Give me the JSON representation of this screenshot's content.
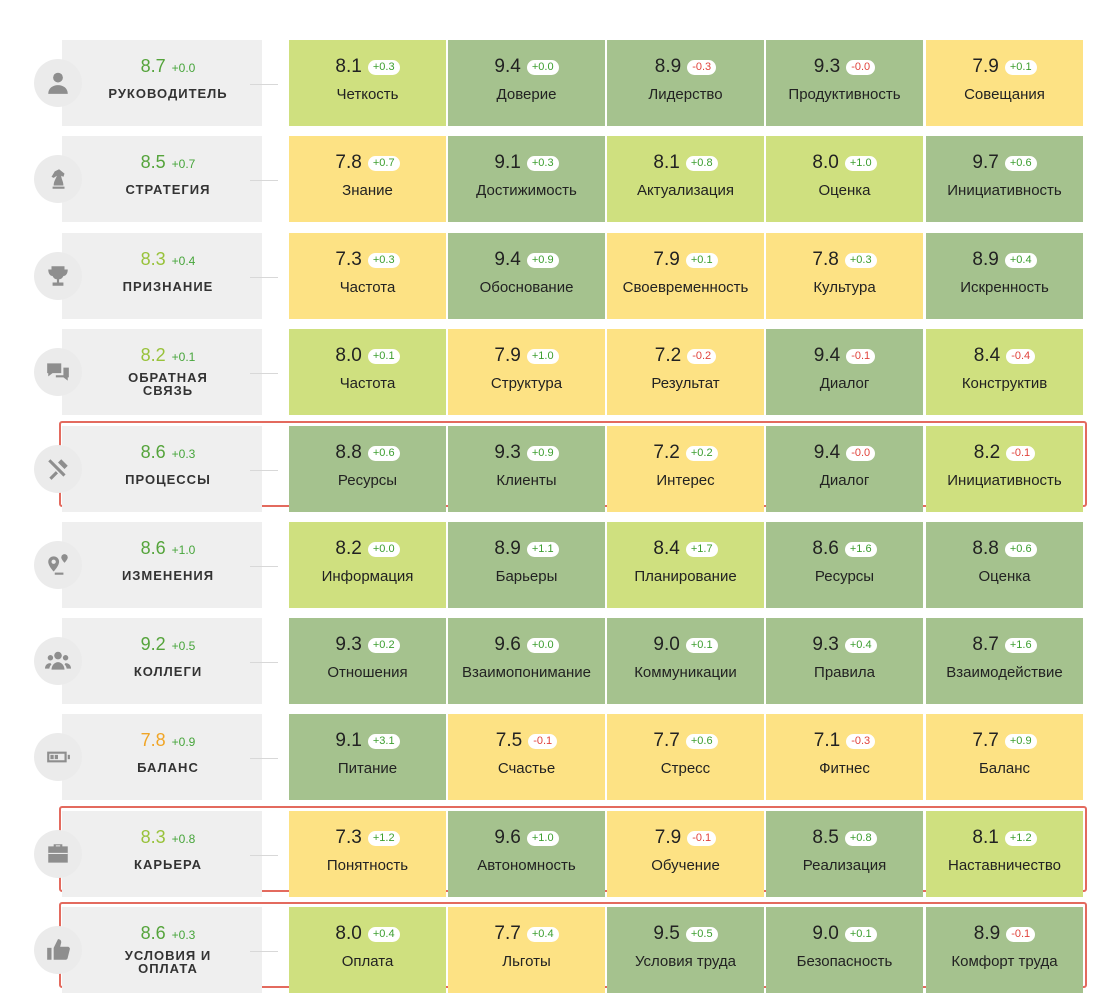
{
  "colors": {
    "dark_green": "#a5c28e",
    "yellow": "#fde284",
    "light_green": "#cfe07f",
    "highlight_border": "#e36a5e",
    "positive": "#3c9e2f",
    "negative": "#e0433c"
  },
  "rows": [
    {
      "icon": "person-icon",
      "score": "8.7",
      "delta": "+0.0",
      "name": "РУКОВОДИТЕЛЬ",
      "score_color": "#55a43b",
      "highlighted": false,
      "cells": [
        {
          "v": "8.1",
          "d": "+0.3",
          "l": "Четкость",
          "c": "lg"
        },
        {
          "v": "9.4",
          "d": "+0.0",
          "l": "Доверие",
          "c": "g"
        },
        {
          "v": "8.9",
          "d": "-0.3",
          "l": "Лидерство",
          "c": "g"
        },
        {
          "v": "9.3",
          "d": "-0.0",
          "l": "Продуктивность",
          "c": "g"
        },
        {
          "v": "7.9",
          "d": "+0.1",
          "l": "Совещания",
          "c": "y"
        }
      ]
    },
    {
      "icon": "chess-knight-icon",
      "score": "8.5",
      "delta": "+0.7",
      "name": "СТРАТЕГИЯ",
      "score_color": "#55a43b",
      "highlighted": false,
      "cells": [
        {
          "v": "7.8",
          "d": "+0.7",
          "l": "Знание",
          "c": "y"
        },
        {
          "v": "9.1",
          "d": "+0.3",
          "l": "Достижимость",
          "c": "g"
        },
        {
          "v": "8.1",
          "d": "+0.8",
          "l": "Актуализация",
          "c": "lg"
        },
        {
          "v": "8.0",
          "d": "+1.0",
          "l": "Оценка",
          "c": "lg"
        },
        {
          "v": "9.7",
          "d": "+0.6",
          "l": "Инициативность",
          "c": "g"
        }
      ]
    },
    {
      "icon": "trophy-icon",
      "score": "8.3",
      "delta": "+0.4",
      "name": "ПРИЗНАНИЕ",
      "score_color": "#98c23a",
      "highlighted": false,
      "cells": [
        {
          "v": "7.3",
          "d": "+0.3",
          "l": "Частота",
          "c": "y"
        },
        {
          "v": "9.4",
          "d": "+0.9",
          "l": "Обоснование",
          "c": "g"
        },
        {
          "v": "7.9",
          "d": "+0.1",
          "l": "Своевременность",
          "c": "y"
        },
        {
          "v": "7.8",
          "d": "+0.3",
          "l": "Культура",
          "c": "y"
        },
        {
          "v": "8.9",
          "d": "+0.4",
          "l": "Искренность",
          "c": "g"
        }
      ]
    },
    {
      "icon": "chat-bubbles-icon",
      "score": "8.2",
      "delta": "+0.1",
      "name": "ОБРАТНАЯ СВЯЗЬ",
      "score_color": "#98c23a",
      "highlighted": false,
      "cells": [
        {
          "v": "8.0",
          "d": "+0.1",
          "l": "Частота",
          "c": "lg"
        },
        {
          "v": "7.9",
          "d": "+1.0",
          "l": "Структура",
          "c": "y"
        },
        {
          "v": "7.2",
          "d": "-0.2",
          "l": "Результат",
          "c": "y"
        },
        {
          "v": "9.4",
          "d": "-0.1",
          "l": "Диалог",
          "c": "g"
        },
        {
          "v": "8.4",
          "d": "-0.4",
          "l": "Конструктив",
          "c": "lg"
        }
      ]
    },
    {
      "icon": "tools-icon",
      "score": "8.6",
      "delta": "+0.3",
      "name": "ПРОЦЕССЫ",
      "score_color": "#55a43b",
      "highlighted": true,
      "cells": [
        {
          "v": "8.8",
          "d": "+0.6",
          "l": "Ресурсы",
          "c": "g"
        },
        {
          "v": "9.3",
          "d": "+0.9",
          "l": "Клиенты",
          "c": "g"
        },
        {
          "v": "7.2",
          "d": "+0.2",
          "l": "Интерес",
          "c": "y"
        },
        {
          "v": "9.4",
          "d": "-0.0",
          "l": "Диалог",
          "c": "g"
        },
        {
          "v": "8.2",
          "d": "-0.1",
          "l": "Инициативность",
          "c": "lg"
        }
      ]
    },
    {
      "icon": "route-pin-icon",
      "score": "8.6",
      "delta": "+1.0",
      "name": "ИЗМЕНЕНИЯ",
      "score_color": "#55a43b",
      "highlighted": false,
      "cells": [
        {
          "v": "8.2",
          "d": "+0.0",
          "l": "Информация",
          "c": "lg"
        },
        {
          "v": "8.9",
          "d": "+1.1",
          "l": "Барьеры",
          "c": "g"
        },
        {
          "v": "8.4",
          "d": "+1.7",
          "l": "Планирование",
          "c": "lg"
        },
        {
          "v": "8.6",
          "d": "+1.6",
          "l": "Ресурсы",
          "c": "g"
        },
        {
          "v": "8.8",
          "d": "+0.6",
          "l": "Оценка",
          "c": "g"
        }
      ]
    },
    {
      "icon": "group-icon",
      "score": "9.2",
      "delta": "+0.5",
      "name": "КОЛЛЕГИ",
      "score_color": "#55a43b",
      "highlighted": false,
      "cells": [
        {
          "v": "9.3",
          "d": "+0.2",
          "l": "Отношения",
          "c": "g"
        },
        {
          "v": "9.6",
          "d": "+0.0",
          "l": "Взаимопонимание",
          "c": "g"
        },
        {
          "v": "9.0",
          "d": "+0.1",
          "l": "Коммуникации",
          "c": "g"
        },
        {
          "v": "9.3",
          "d": "+0.4",
          "l": "Правила",
          "c": "g"
        },
        {
          "v": "8.7",
          "d": "+1.6",
          "l": "Взаимодействие",
          "c": "g"
        }
      ]
    },
    {
      "icon": "battery-icon",
      "score": "7.8",
      "delta": "+0.9",
      "name": "БАЛАНС",
      "score_color": "#f0a526",
      "highlighted": false,
      "cells": [
        {
          "v": "9.1",
          "d": "+3.1",
          "l": "Питание",
          "c": "g"
        },
        {
          "v": "7.5",
          "d": "-0.1",
          "l": "Счастье",
          "c": "y"
        },
        {
          "v": "7.7",
          "d": "+0.6",
          "l": "Стресс",
          "c": "y"
        },
        {
          "v": "7.1",
          "d": "-0.3",
          "l": "Фитнес",
          "c": "y"
        },
        {
          "v": "7.7",
          "d": "+0.9",
          "l": "Баланс",
          "c": "y"
        }
      ]
    },
    {
      "icon": "briefcase-icon",
      "score": "8.3",
      "delta": "+0.8",
      "name": "КАРЬЕРА",
      "score_color": "#98c23a",
      "highlighted": true,
      "cells": [
        {
          "v": "7.3",
          "d": "+1.2",
          "l": "Понятность",
          "c": "y"
        },
        {
          "v": "9.6",
          "d": "+1.0",
          "l": "Автономность",
          "c": "g"
        },
        {
          "v": "7.9",
          "d": "-0.1",
          "l": "Обучение",
          "c": "y"
        },
        {
          "v": "8.5",
          "d": "+0.8",
          "l": "Реализация",
          "c": "g"
        },
        {
          "v": "8.1",
          "d": "+1.2",
          "l": "Наставничество",
          "c": "lg"
        }
      ]
    },
    {
      "icon": "thumbs-up-icon",
      "score": "8.6",
      "delta": "+0.3",
      "name": "УСЛОВИЯ И ОПЛАТА",
      "score_color": "#55a43b",
      "highlighted": true,
      "cells": [
        {
          "v": "8.0",
          "d": "+0.4",
          "l": "Оплата",
          "c": "lg"
        },
        {
          "v": "7.7",
          "d": "+0.4",
          "l": "Льготы",
          "c": "y"
        },
        {
          "v": "9.5",
          "d": "+0.5",
          "l": "Условия труда",
          "c": "g"
        },
        {
          "v": "9.0",
          "d": "+0.1",
          "l": "Безопасность",
          "c": "g"
        },
        {
          "v": "8.9",
          "d": "-0.1",
          "l": "Комфорт труда",
          "c": "g"
        }
      ]
    }
  ]
}
